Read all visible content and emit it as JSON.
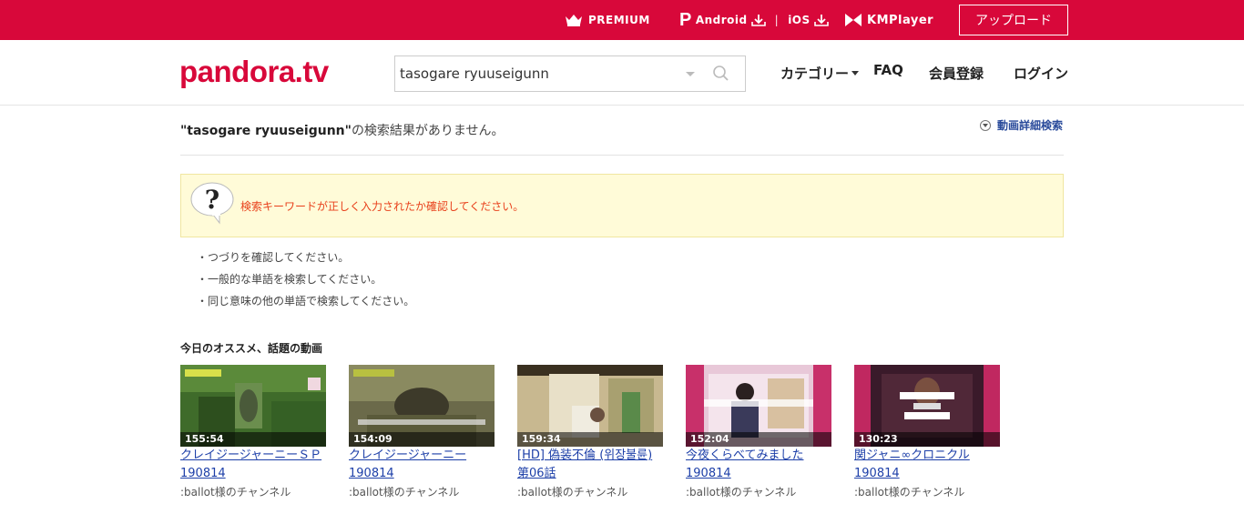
{
  "topbar": {
    "premium": "PREMIUM",
    "android": "Android",
    "ios": "iOS",
    "separator": "|",
    "kmplayer": "KMPlayer",
    "upload": "アップロード"
  },
  "header": {
    "logo": "pandora.tv",
    "search_value": "tasogare ryuuseigunn",
    "nav": {
      "category": "カテゴリー",
      "faq": "FAQ",
      "register": "会員登録",
      "login": "ログイン"
    }
  },
  "results": {
    "query": "\"tasogare ryuuseigunn\"",
    "no_results_suffix": "の検索結果がありません。",
    "advanced_search": "動画詳細検索"
  },
  "notice": {
    "message": "検索キーワードが正しく入力されたか確認してください。"
  },
  "tips": [
    "・つづりを確認してください。",
    "・一般的な単語を検索してください。",
    "・同じ意味の他の単語で検索してください。"
  ],
  "recommend": {
    "title": "今日のオススメ、話題の動画",
    "videos": [
      {
        "duration": "155:54",
        "title": "クレイジージャーニーＳＰ\n190814",
        "channel": ":ballot様のチャンネル"
      },
      {
        "duration": "154:09",
        "title": "クレイジージャーニー\n190814",
        "channel": ":ballot様のチャンネル"
      },
      {
        "duration": "159:34",
        "title": "[HD] 偽装不倫 (위장불륜)\n第06話",
        "channel": ":ballot様のチャンネル"
      },
      {
        "duration": "152:04",
        "title": "今夜くらべてみました\n190814",
        "channel": ":ballot様のチャンネル"
      },
      {
        "duration": "130:23",
        "title": "関ジャニ∞クロニクル\n190814",
        "channel": ":ballot様のチャンネル"
      }
    ]
  },
  "colors": {
    "brand": "#d8083a",
    "link": "#1d3fa8",
    "notice_bg": "#fffbd8",
    "notice_text": "#e8401b"
  }
}
